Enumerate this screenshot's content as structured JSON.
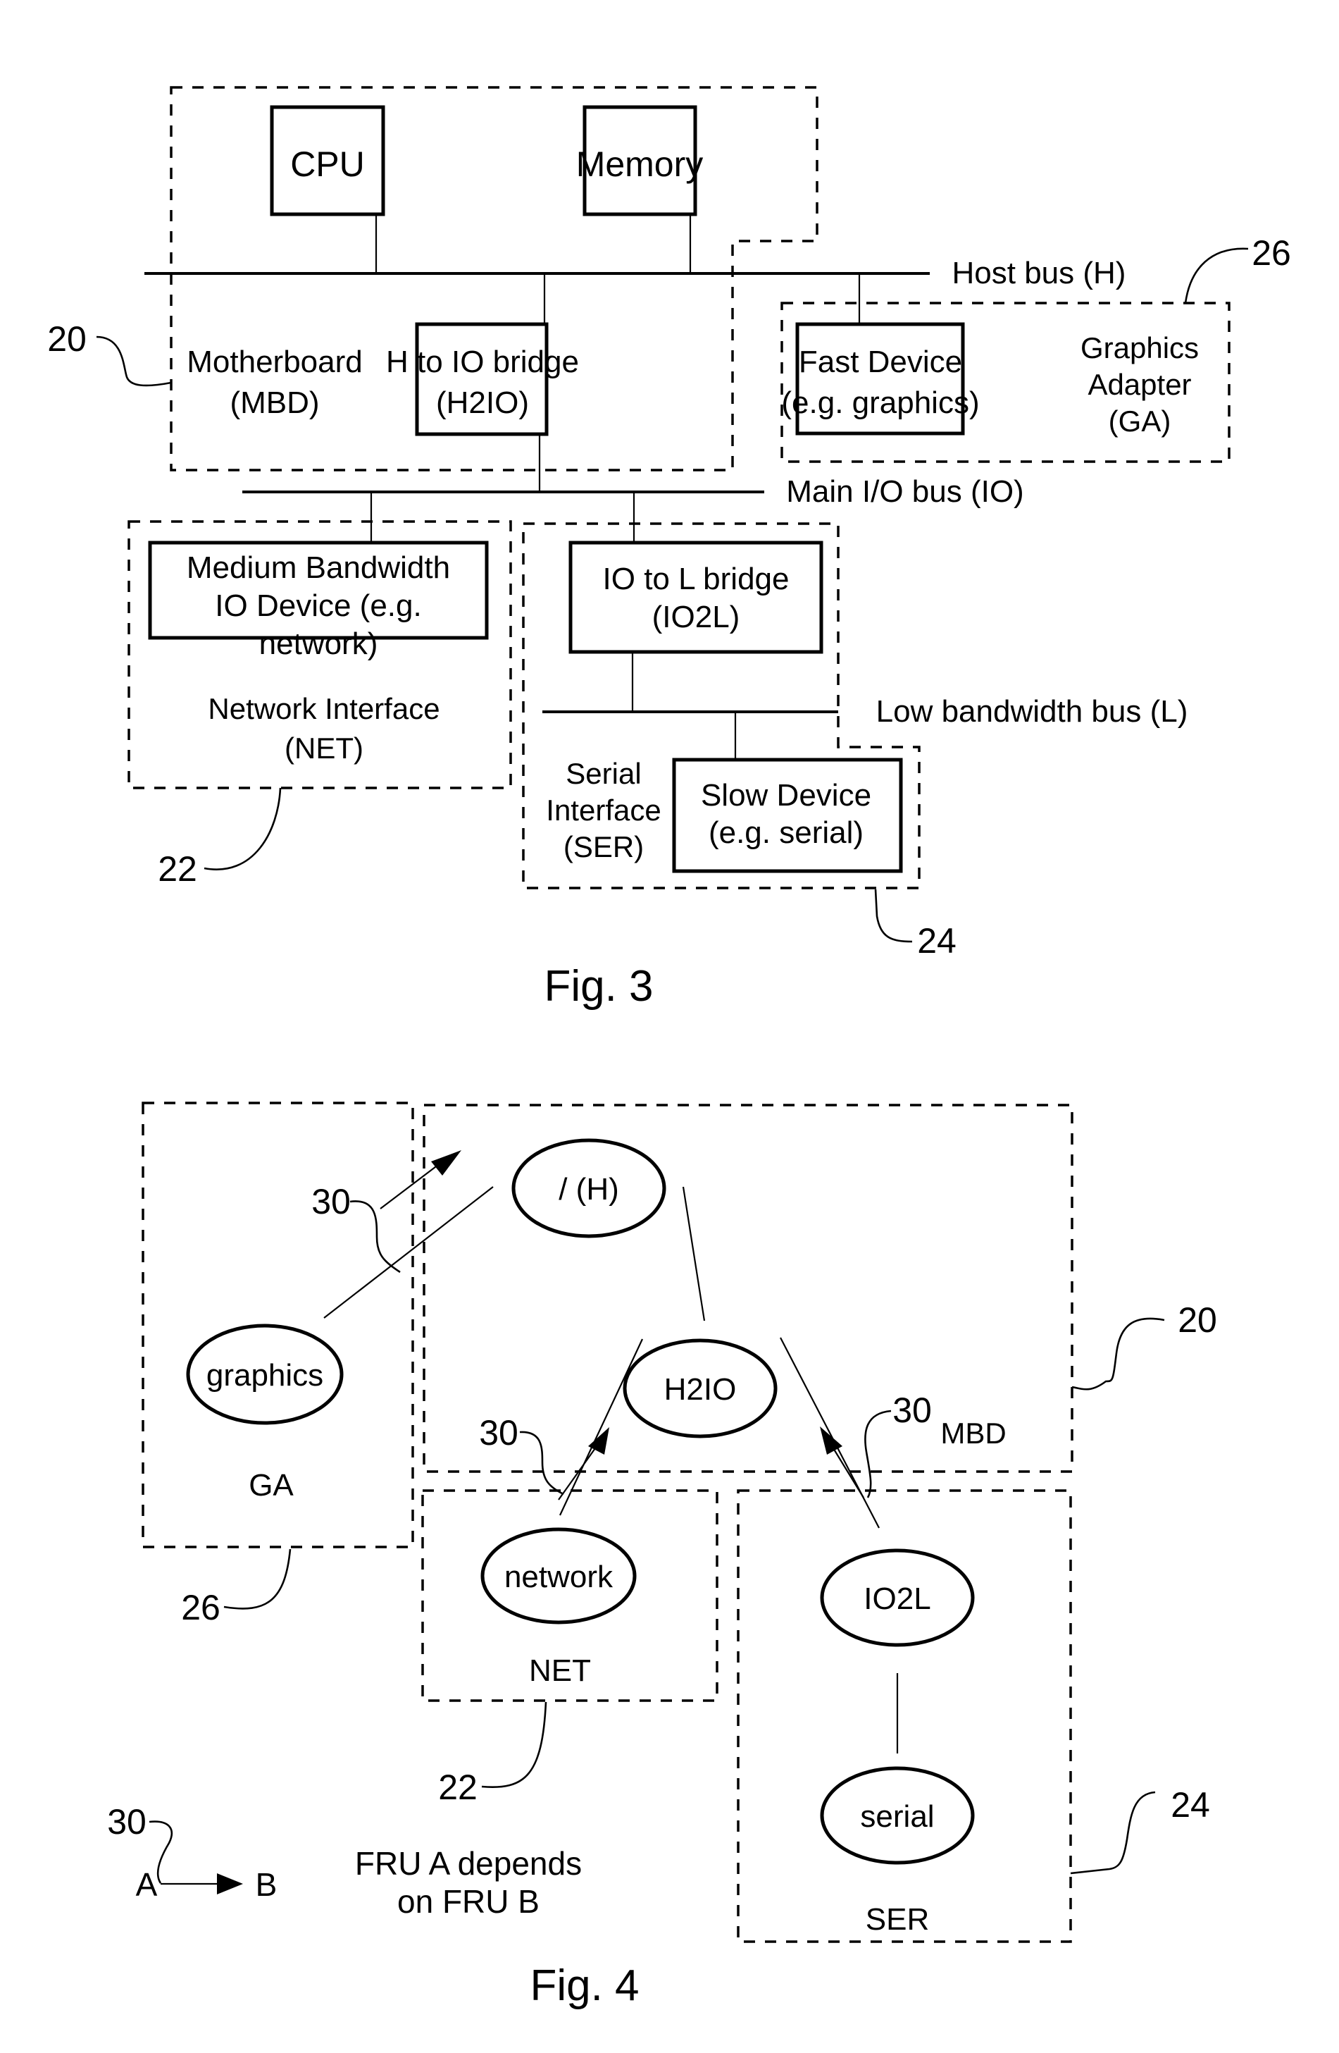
{
  "fig3": {
    "caption": "Fig. 3",
    "boxes": {
      "cpu": "CPU",
      "memory": "Memory",
      "h2io": [
        "H to IO bridge",
        "(H2IO)"
      ],
      "fast_device": [
        "Fast Device",
        "(e.g. graphics)"
      ],
      "medium_device": [
        "Medium Bandwidth",
        "IO Device (e.g.",
        "network)"
      ],
      "io2l": [
        "IO to L bridge",
        "(IO2L)"
      ],
      "slow_device": [
        "Slow Device",
        "(e.g. serial)"
      ]
    },
    "groups": {
      "motherboard": [
        "Motherboard",
        "(MBD)"
      ],
      "graphics_adapter": [
        "Graphics",
        "Adapter",
        "(GA)"
      ],
      "network_interface": [
        "Network Interface",
        "(NET)"
      ],
      "serial_interface": [
        "Serial",
        "Interface",
        "(SER)"
      ]
    },
    "buses": {
      "host": "Host bus (H)",
      "main_io": "Main I/O bus (IO)",
      "low": "Low bandwidth bus (L)"
    },
    "refs": {
      "mbd": "20",
      "net": "22",
      "ser": "24",
      "ga": "26"
    }
  },
  "fig4": {
    "caption": "Fig. 4",
    "nodes": {
      "host": "/ (H)",
      "graphics": "graphics",
      "h2io": "H2IO",
      "network": "network",
      "io2l": "IO2L",
      "serial": "serial"
    },
    "groups": {
      "ga": "GA",
      "net": "NET",
      "ser": "SER"
    },
    "refs": {
      "arrow_ga": "30",
      "arrow_net": "30",
      "arrow_mbd_main": "30",
      "arrow_mbd_sub": "MBD",
      "mbd": "20",
      "ga": "26",
      "net": "22",
      "ser": "24",
      "legend": "30"
    },
    "legend": {
      "a": "A",
      "b": "B",
      "text": [
        "FRU A depends",
        "on FRU B"
      ]
    }
  }
}
